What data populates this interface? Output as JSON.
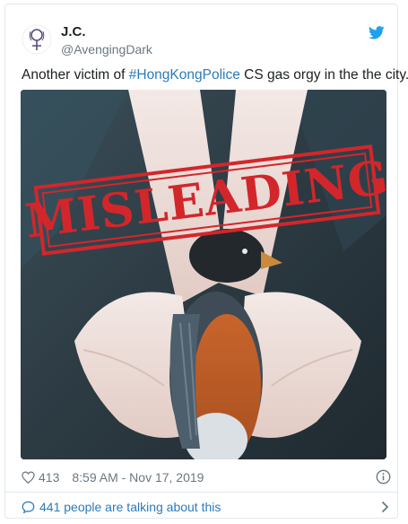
{
  "tweet": {
    "author": {
      "display_name": "J.C.",
      "handle": "@AvengingDark"
    },
    "text_before": "Another victim of ",
    "hashtag": "#HongKongPolice",
    "text_after": " CS gas orgy in the the city.",
    "stamp_label": "MISLEADING",
    "likes": "413",
    "timestamp": "8:59 AM - Nov 17, 2019",
    "talking": "441 people are talking about this"
  },
  "colors": {
    "link": "#2b7bb9",
    "muted": "#697882",
    "stamp_red": "#d3262b",
    "border": "#e1e8ed"
  },
  "icons": {
    "brand": "twitter-bird-icon",
    "like": "heart-icon",
    "info": "info-icon",
    "reply": "speech-bubble-icon",
    "more": "chevron-right-icon"
  }
}
